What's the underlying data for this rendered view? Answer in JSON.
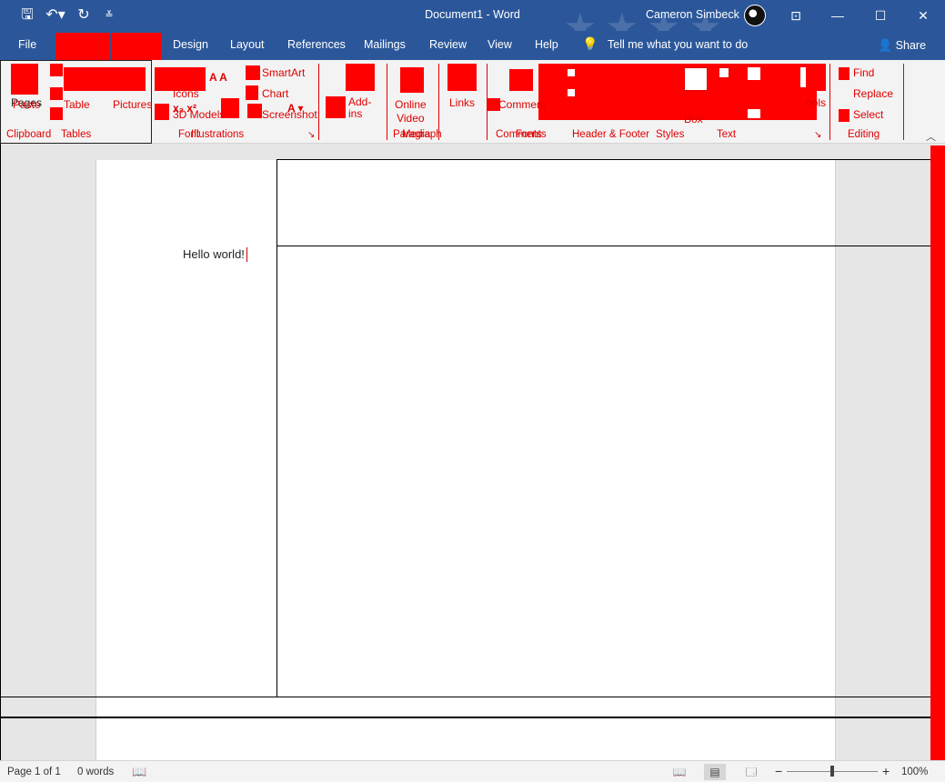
{
  "window": {
    "title": "Document1  -  Word",
    "user": "Cameron Simbeck",
    "controls": {
      "ribbon_options": "⊡",
      "minimize": "—",
      "maximize": "☐",
      "close": "✕"
    },
    "qat": {
      "save": "🖫",
      "undo": "↶▾",
      "redo": "↻",
      "customize": "≚"
    }
  },
  "tabs": {
    "file": "File",
    "design": "Design",
    "layout": "Layout",
    "references": "References",
    "mailings": "Mailings",
    "review": "Review",
    "view": "View",
    "help": "Help",
    "tell_me": "Tell me what you want to do",
    "share": "Share"
  },
  "ribbon": {
    "paste": "Paste",
    "pages": "Pages",
    "table": "Table",
    "pictures": "Pictures",
    "icons": "Icons",
    "models_3d": "3D Models",
    "smartart": "SmartArt",
    "chart": "Chart",
    "screenshot": "Screenshot",
    "add_ins": "Add-\nins",
    "online_video": "Online\nVideo",
    "links": "Links",
    "comment": "Comment",
    "box": "Box",
    "tools": "ools",
    "find": "Find",
    "replace": "Replace",
    "select": "Select",
    "groups": {
      "clipboard": "Clipboard",
      "tables": "Tables",
      "font": "Font",
      "illustrations": "Illustrations",
      "paragraph": "Paragraph",
      "media": "Media",
      "comments": "Comments",
      "fonts_overlap": "Fonts",
      "header_footer": "Header & Footer",
      "styles": "Styles",
      "text": "Text",
      "editing": "Editing"
    }
  },
  "document": {
    "body_text": "Hello world!"
  },
  "status": {
    "page": "Page 1 of 1",
    "words": "0 words",
    "zoom": "100%",
    "zoom_out": "−",
    "zoom_in": "+"
  },
  "colors": {
    "titlebar": "#2b579a",
    "redaction": "#ff0000",
    "ribbon": "#f3f3f3"
  }
}
